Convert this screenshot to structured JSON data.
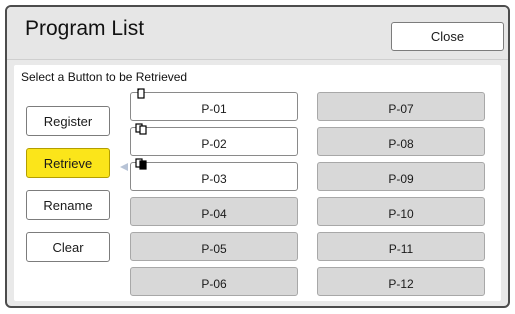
{
  "header": {
    "title": "Program List",
    "close_label": "Close"
  },
  "instruction": "Select a Button to be Retrieved",
  "side_buttons": [
    {
      "label": "Register",
      "active": false
    },
    {
      "label": "Retrieve",
      "active": true
    },
    {
      "label": "Rename",
      "active": false
    },
    {
      "label": "Clear",
      "active": false
    }
  ],
  "programs": [
    {
      "label": "P-01",
      "stored": true,
      "icon": "single-page-icon"
    },
    {
      "label": "P-02",
      "stored": true,
      "icon": "multi-page-icon"
    },
    {
      "label": "P-03",
      "stored": true,
      "icon": "multi-page-black-icon"
    },
    {
      "label": "P-04",
      "stored": false
    },
    {
      "label": "P-05",
      "stored": false
    },
    {
      "label": "P-06",
      "stored": false
    },
    {
      "label": "P-07",
      "stored": false
    },
    {
      "label": "P-08",
      "stored": false
    },
    {
      "label": "P-09",
      "stored": false
    },
    {
      "label": "P-10",
      "stored": false
    },
    {
      "label": "P-11",
      "stored": false
    },
    {
      "label": "P-12",
      "stored": false
    }
  ],
  "colors": {
    "accent": "#fbe51a",
    "empty_slot": "#d8d8d8"
  }
}
